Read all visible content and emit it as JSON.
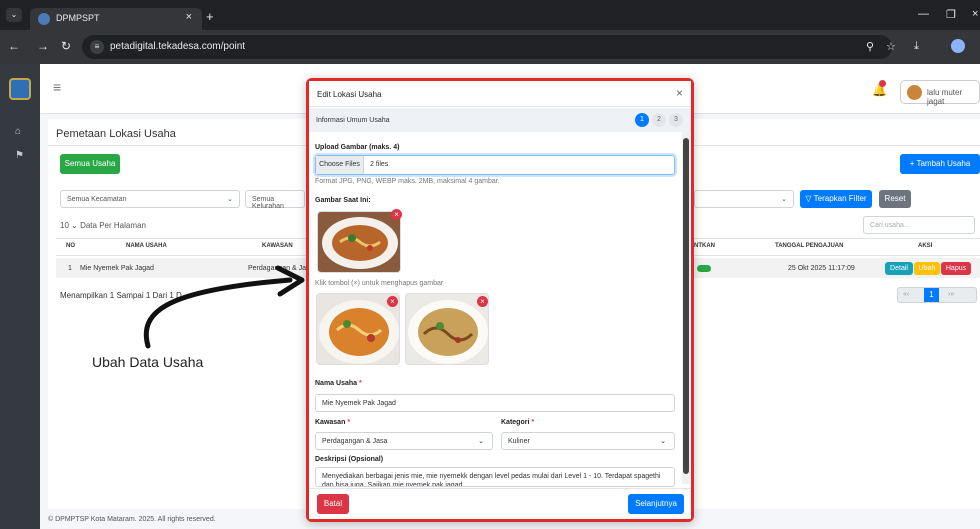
{
  "browser": {
    "tab_title": "DPMPSPT",
    "url": "petadigital.tekadesa.com/point"
  },
  "app": {
    "page_title": "Pemetaan Lokasi Usaha",
    "user": "lalu muter jagat",
    "btn_semua": "Semua Usaha",
    "btn_tambah": "+ Tambah Usaha",
    "sel_kecamatan": "Semua Kecamatan",
    "sel_kelurahan": "Semua Kelurahan",
    "btn_filter": "▽ Terapkan Filter",
    "btn_reset": "Reset",
    "perpage_value": "10",
    "perpage_label": "Data Per Halaman",
    "search_placeholder": "Cari usaha...",
    "headers": {
      "no": "NO",
      "nama": "NAMA USAHA",
      "kawasan": "KAWASAN",
      "status": "NTKAN",
      "tanggal": "TANGGAL PENGAJUAN",
      "aksi": "AKSI"
    },
    "row": {
      "no": "1",
      "nama": "Mie Nyemek Pak Jagad",
      "kawasan": "Perdagangan & Jas",
      "tanggal": "25 Okt 2025 11:17:09"
    },
    "actions": {
      "detail": "Detail",
      "ubah": "Ubah",
      "hapus": "Hapus"
    },
    "showing": "Menampilkan 1 Sampai 1 Dari 1 D",
    "page": "1",
    "footer": "© DPMPTSP Kota Mataram. 2025. All rights reserved.",
    "annotation": "Ubah Data Usaha"
  },
  "modal": {
    "title": "Edit Lokasi Usaha",
    "step_label": "Informasi Umum Usaha",
    "steps": [
      "1",
      "2",
      "3"
    ],
    "upload_label": "Upload Gambar (maks. 4)",
    "choose": "Choose Files",
    "files": "2 files",
    "format_hint": "Format JPG, PNG, WEBP maks. 2MB, maksimal 4 gambar.",
    "current_label": "Gambar Saat Ini:",
    "delete_hint": "Klik tombol (×) untuk menghapus gambar",
    "nama_label": "Nama Usaha",
    "nama_value": "Mie Nyemek Pak Jagad",
    "kawasan_label": "Kawasan",
    "kawasan_value": "Perdagangan & Jasa",
    "kategori_label": "Kategori",
    "kategori_value": "Kuliner",
    "desc_label": "Deskripsi (Opsional)",
    "desc_value": "Menyediakan berbagai jenis mie, mie nyemekk dengan level pedas mulai dari Level 1 - 10. Terdapat spagethi dan bisa juga. Sajikan mie nyemek pak jagad",
    "required_mark": "*",
    "btn_batal": "Batal",
    "btn_next": "Selanjutnya"
  }
}
